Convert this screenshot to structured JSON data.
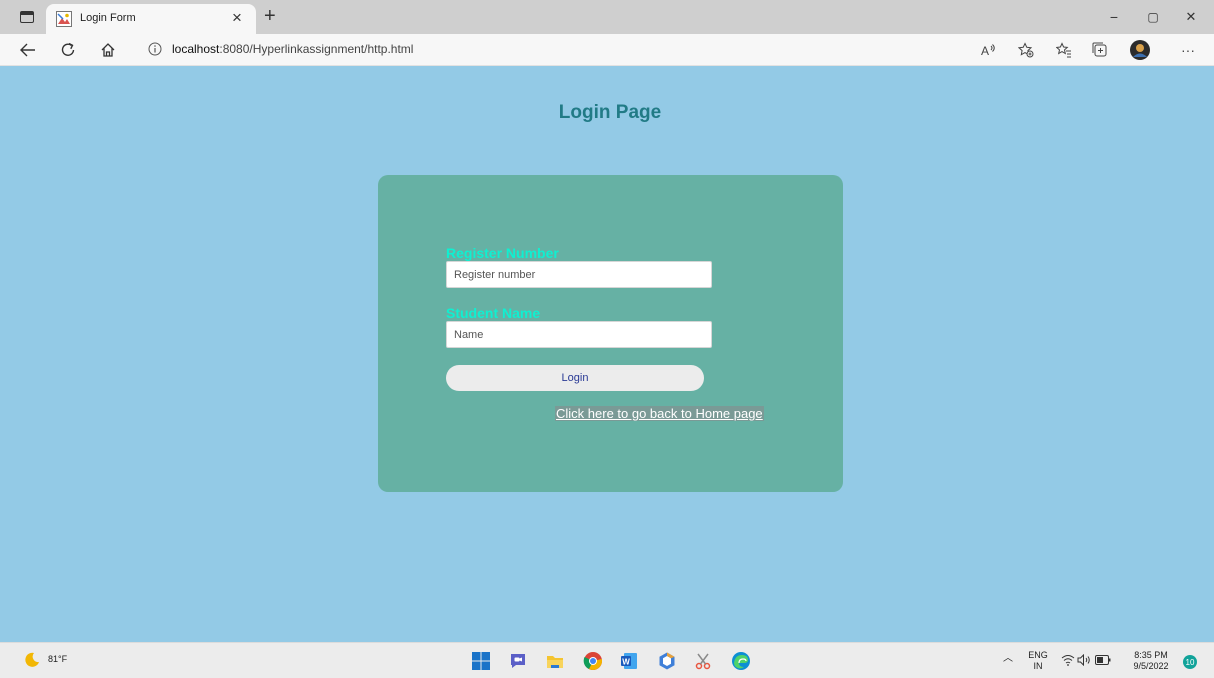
{
  "browser": {
    "tab_title": "Login Form",
    "tab_close": "×",
    "new_tab": "+",
    "url_host": "localhost",
    "url_rest": ":8080/Hyperlinkassignment/http.html",
    "window_minimize": "−",
    "window_restore": "▢",
    "window_close": "✕",
    "more_menu": "···"
  },
  "page": {
    "title": "Login Page",
    "register_label": "Register Number",
    "register_placeholder": "Register number",
    "register_value": "",
    "name_label": "Student Name",
    "name_placeholder": "Name",
    "name_value": "",
    "login_button": "Login",
    "home_link": "Click here to go back to Home page"
  },
  "taskbar": {
    "weather_temp": "81°F",
    "lang_top": "ENG",
    "lang_bottom": "IN",
    "time": "8:35 PM",
    "date": "9/5/2022",
    "notification_count": "10",
    "apps": [
      "start",
      "teams-chat",
      "file-explorer",
      "chrome",
      "word",
      "app",
      "snipping-tool",
      "edge"
    ]
  },
  "colors": {
    "page_bg": "#93cae6",
    "card_bg": "#66b1a4",
    "title_color": "#217b86",
    "label_color": "#0ff0d1",
    "button_text": "#2a3a95"
  }
}
